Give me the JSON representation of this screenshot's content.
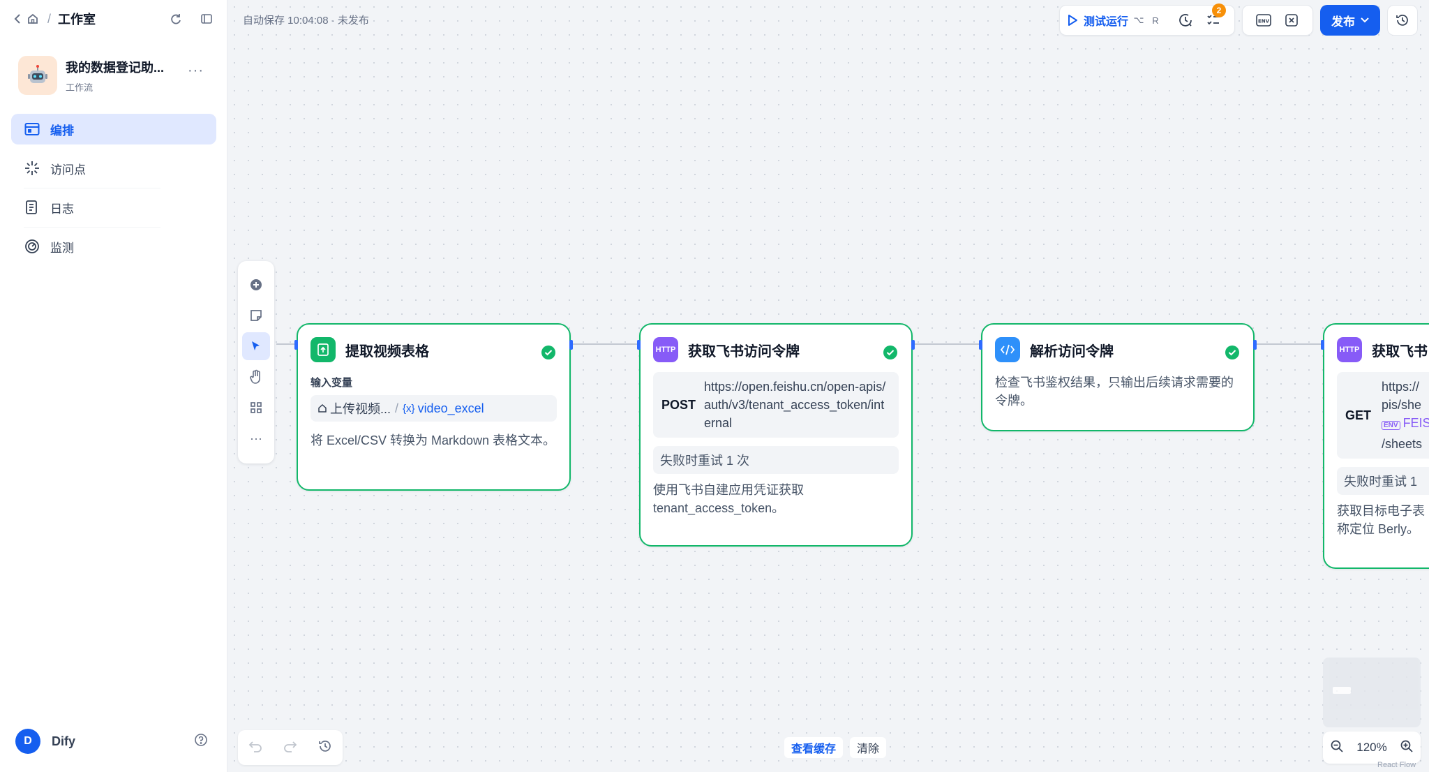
{
  "breadcrumb": {
    "title": "工作室"
  },
  "app": {
    "name": "我的数据登记助...",
    "type": "工作流"
  },
  "nav": [
    {
      "label": "编排",
      "icon": "layout-icon",
      "active": true
    },
    {
      "label": "访问点",
      "icon": "sparkle-icon",
      "active": false
    },
    {
      "label": "日志",
      "icon": "log-icon",
      "active": false
    },
    {
      "label": "监测",
      "icon": "gauge-icon",
      "active": false
    }
  ],
  "user": {
    "initial": "D",
    "name": "Dify"
  },
  "canvas": {
    "autosave": "自动保存 10:04:08 · 未发布"
  },
  "toolbar": {
    "run_label": "测试运行",
    "run_kbd_1": "⌥",
    "run_kbd_2": "R",
    "checklist_badge": "2",
    "publish_label": "发布"
  },
  "nodes": {
    "n1": {
      "title": "提取视频表格",
      "section_label": "输入变量",
      "var_source": "上传视频...",
      "var_name": "video_excel",
      "desc": "将 Excel/CSV 转换为 Markdown 表格文本。",
      "icon_color": "#12b76a"
    },
    "n2": {
      "title": "获取飞书访问令牌",
      "method": "POST",
      "url": "https://open.feishu.cn/open-apis/auth/v3/tenant_access_token/internal",
      "retry": "失败时重试 1 次",
      "desc": "使用飞书自建应用凭证获取 tenant_access_token。",
      "icon_label": "HTTP",
      "icon_color": "#875bf7"
    },
    "n3": {
      "title": "解析访问令牌",
      "desc": "检查飞书鉴权结果，只输出后续请求需要的令牌。",
      "icon_color": "#2e90fa"
    },
    "n4": {
      "title": "获取飞书",
      "method": "GET",
      "url_line1": "https://",
      "url_line2": "pis/she",
      "url_env": "FEIS",
      "url_line3": "/sheets",
      "retry": "失败时重试 1",
      "desc_line1": "获取目标电子表",
      "desc_line2": "称定位 Berly。",
      "icon_label": "HTTP",
      "icon_color": "#875bf7"
    }
  },
  "bottom": {
    "view_cache": "查看缓存",
    "clear": "清除",
    "zoom": "120%",
    "react_flow": "React Flow"
  },
  "colors": {
    "accent": "#155eef",
    "success": "#12b76a"
  }
}
